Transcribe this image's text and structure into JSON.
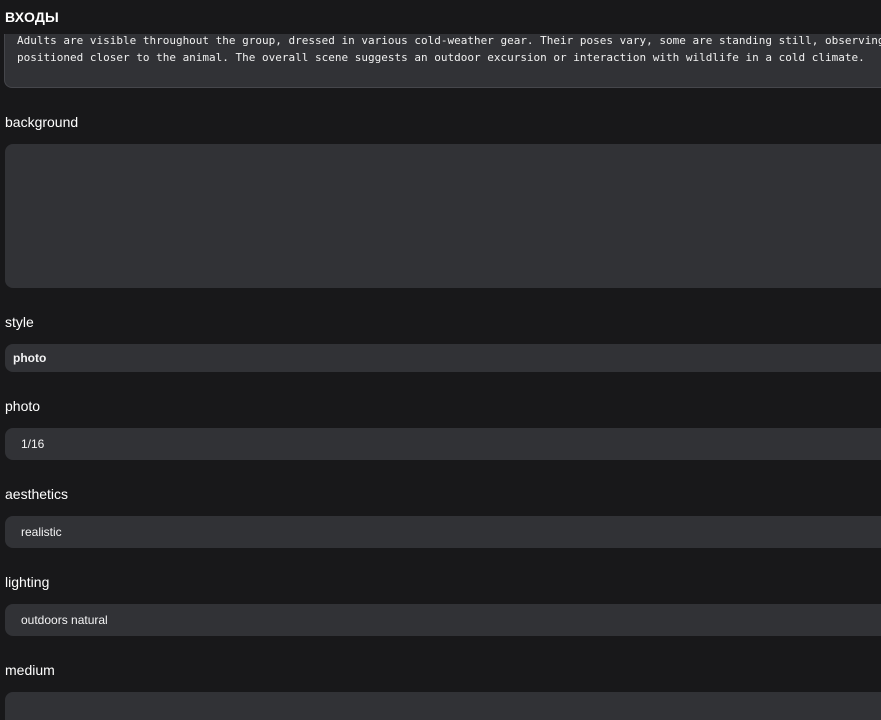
{
  "section": {
    "title": "ВХОДЫ"
  },
  "description": {
    "line1": "Adults are visible throughout the group, dressed in various cold-weather gear. Their poses vary, some are standing still, observing",
    "line2": "positioned closer to the animal. The overall scene suggests an outdoor excursion or interaction with wildlife in a cold climate."
  },
  "fields": {
    "background": {
      "label": "background",
      "value": ""
    },
    "style": {
      "label": "style",
      "value": "photo"
    },
    "photo": {
      "label": "photo",
      "value": "1/16"
    },
    "aesthetics": {
      "label": "aesthetics",
      "value": "realistic"
    },
    "lighting": {
      "label": "lighting",
      "value": "outdoors natural"
    },
    "medium": {
      "label": "medium",
      "value": ""
    }
  }
}
